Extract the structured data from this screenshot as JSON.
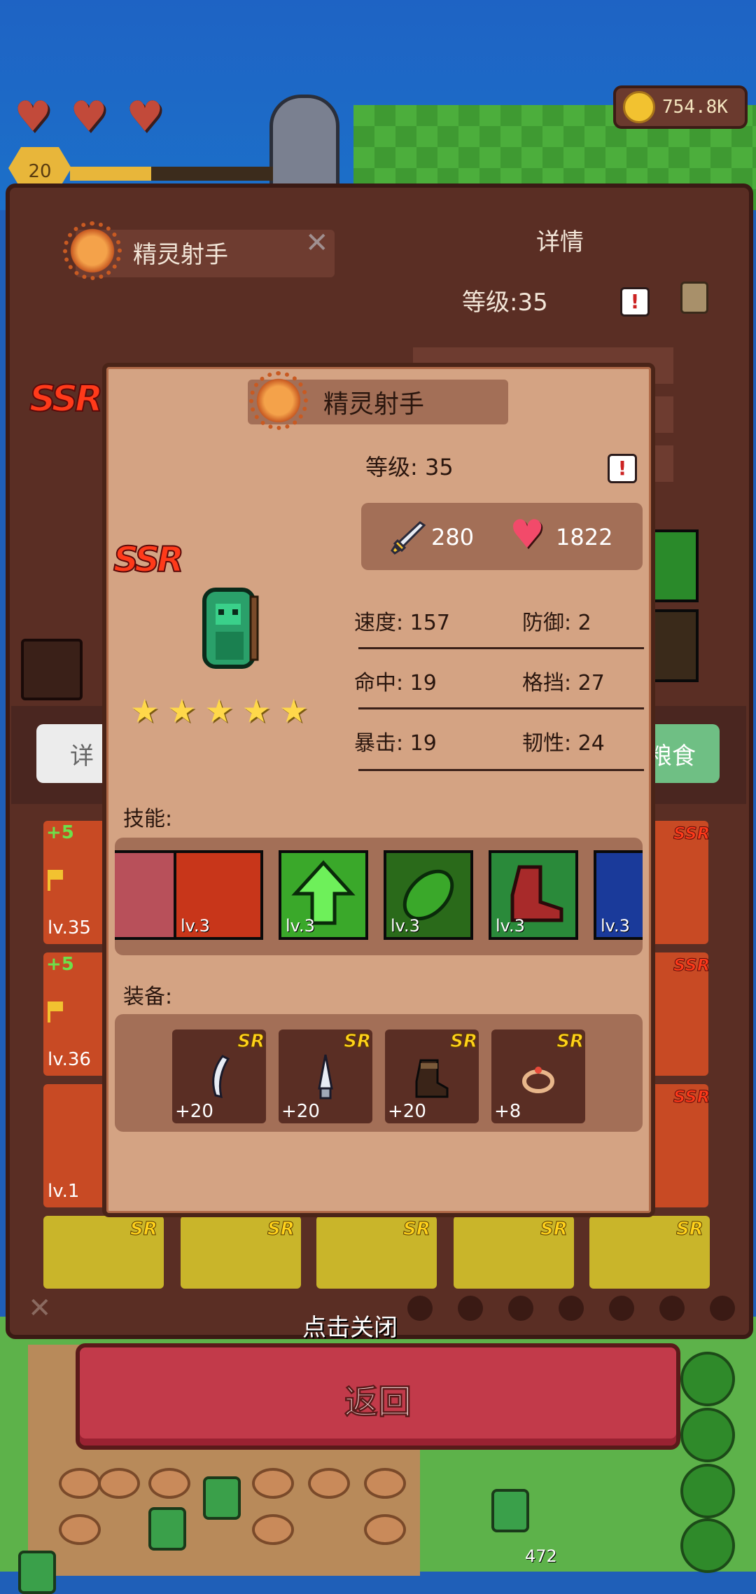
{
  "top_bar": {
    "hearts": 3,
    "player_level": "20",
    "coins": "754.8K"
  },
  "back_panel": {
    "hero_name": "精灵射手",
    "detail_title": "详情",
    "level_text": "等级:35",
    "rarity": "SSR",
    "tab_left": "详",
    "tab_right": "粮食",
    "cards": [
      {
        "plus": "+5",
        "level": "lv.35",
        "rarity": "SSR"
      },
      {
        "plus": "+5",
        "level": "lv.36",
        "rarity": "SSR"
      },
      {
        "plus": "",
        "level": "lv.1",
        "rarity": "SSR"
      }
    ],
    "bottom_row_rarity": "SR",
    "tap_to_close": "点击关闭"
  },
  "popup": {
    "hero_name": "精灵射手",
    "level_text": "等级: 35",
    "rarity": "SSR",
    "attack": "280",
    "hp": "1822",
    "stars": 5,
    "stats": [
      {
        "label": "速度: 157",
        "label2": "防御: 2"
      },
      {
        "label": "命中: 19",
        "label2": "格挡: 27"
      },
      {
        "label": "暴击: 19",
        "label2": "韧性: 24"
      }
    ],
    "skills_label": "技能:",
    "skills": [
      {
        "level": "",
        "color": "#b8505a"
      },
      {
        "level": "lv.3",
        "color": "#c8361a"
      },
      {
        "level": "lv.3",
        "color": "#3aa82a"
      },
      {
        "level": "lv.3",
        "color": "#2a6a1a"
      },
      {
        "level": "lv.3",
        "color": "#2a8a3a"
      },
      {
        "level": "lv.3",
        "color": "#1a3a9a"
      }
    ],
    "equipment_label": "装备:",
    "equipment": [
      {
        "rarity": "SR",
        "plus": "+20",
        "icon": "curved-blade-icon"
      },
      {
        "rarity": "SR",
        "plus": "+20",
        "icon": "dagger-icon"
      },
      {
        "rarity": "SR",
        "plus": "+20",
        "icon": "boots-icon"
      },
      {
        "rarity": "SR",
        "plus": "+8",
        "icon": "ring-icon"
      }
    ]
  },
  "return_button": "返回",
  "footer_count": "472"
}
